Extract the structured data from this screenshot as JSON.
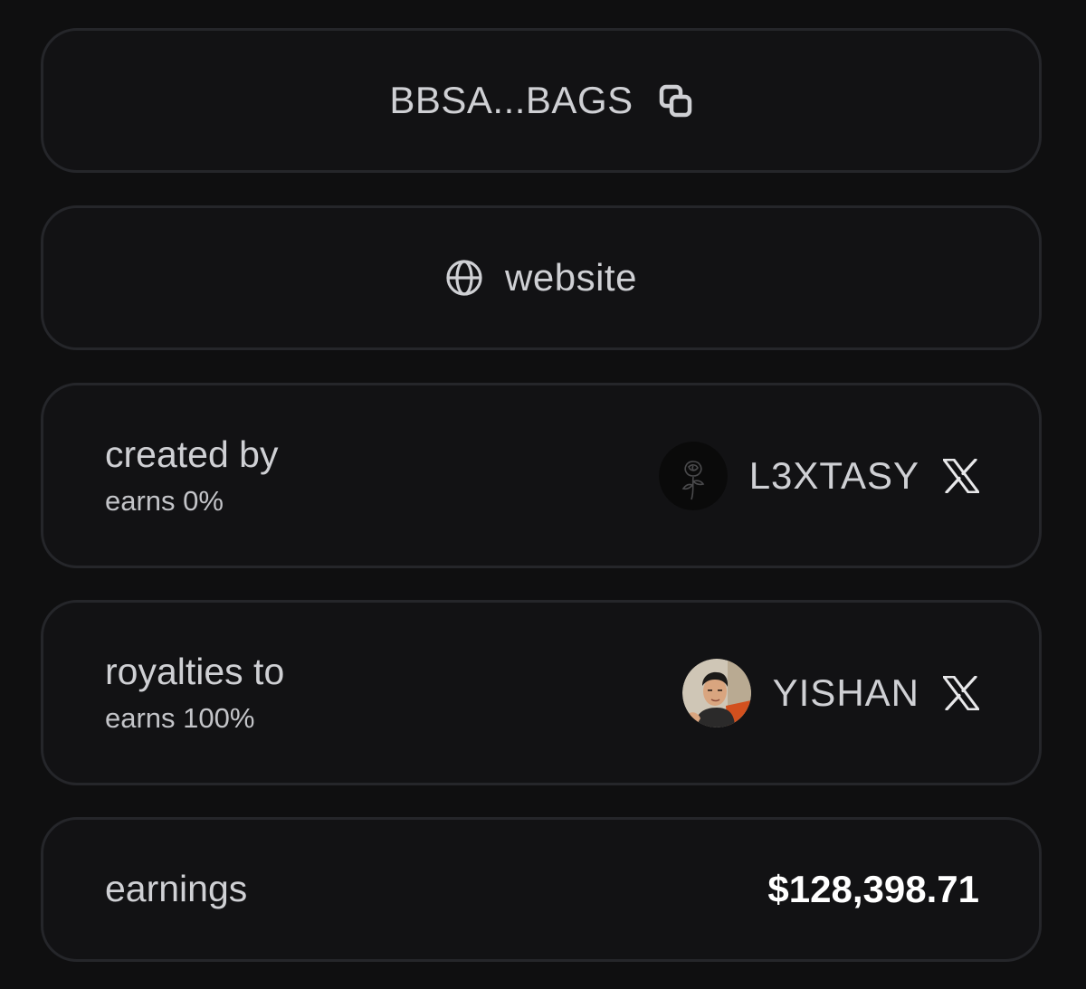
{
  "token": {
    "address_short": "BBSA...BAGS",
    "copy_icon": "copy-icon"
  },
  "website": {
    "label": "website",
    "icon": "globe-icon"
  },
  "creator": {
    "label": "created by",
    "earns": "earns 0%",
    "name": "L3XTASY",
    "social_icon": "x-icon"
  },
  "royalties": {
    "label": "royalties to",
    "earns": "earns 100%",
    "name": "YISHAN",
    "social_icon": "x-icon"
  },
  "earnings": {
    "label": "earnings",
    "value": "$128,398.71"
  },
  "colors": {
    "background": "#0f0f10",
    "card": "#121214",
    "card_border": "#25262a",
    "text": "#cfd0d4",
    "value_text": "#ffffff"
  }
}
